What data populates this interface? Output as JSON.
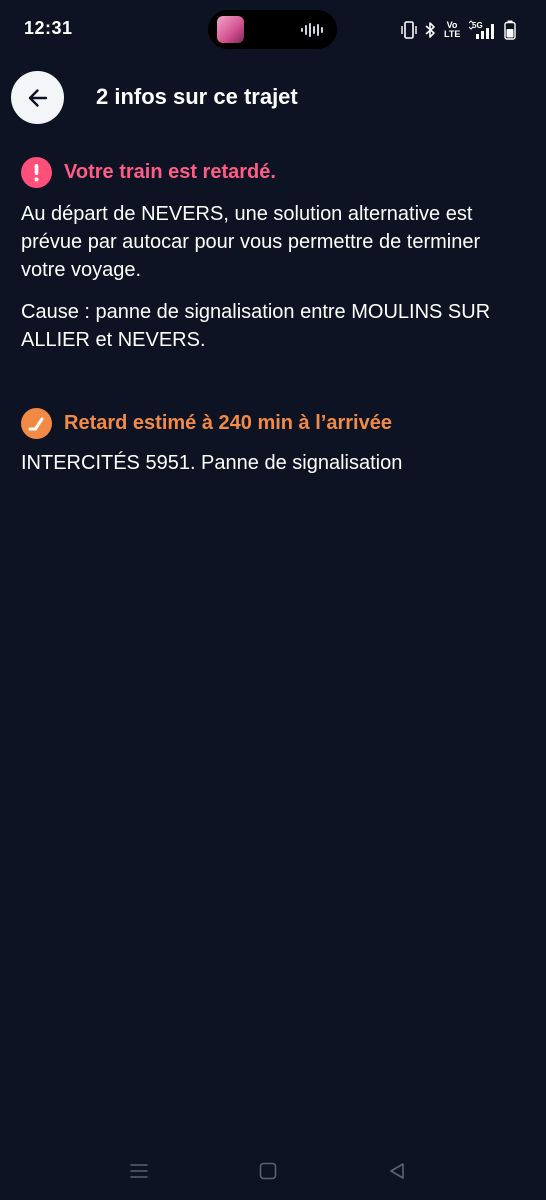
{
  "status_bar": {
    "time": "12:31",
    "volte_top": "Vo",
    "volte_bottom": "LTE",
    "network": "5G"
  },
  "header": {
    "title": "2 infos sur ce trajet",
    "back_icon": "arrow-left-icon"
  },
  "alerts": [
    {
      "icon": "exclamation-icon",
      "color": "#ff5c86",
      "title": "Votre train est retardé.",
      "paragraphs": [
        "Au départ de NEVERS, une solution alternative est prévue par autocar pour vous permettre de terminer votre voyage.",
        "Cause : panne de signalisation entre MOULINS SUR ALLIER et NEVERS."
      ]
    },
    {
      "icon": "clock-icon",
      "color": "#f28a46",
      "title": "Retard estimé à 240 min à l’arrivée",
      "paragraphs": [
        "INTERCITÉS 5951. Panne de signalisation"
      ]
    }
  ],
  "nav_bar": {
    "icons": [
      "menu-icon",
      "home-icon",
      "back-triangle-icon"
    ]
  }
}
